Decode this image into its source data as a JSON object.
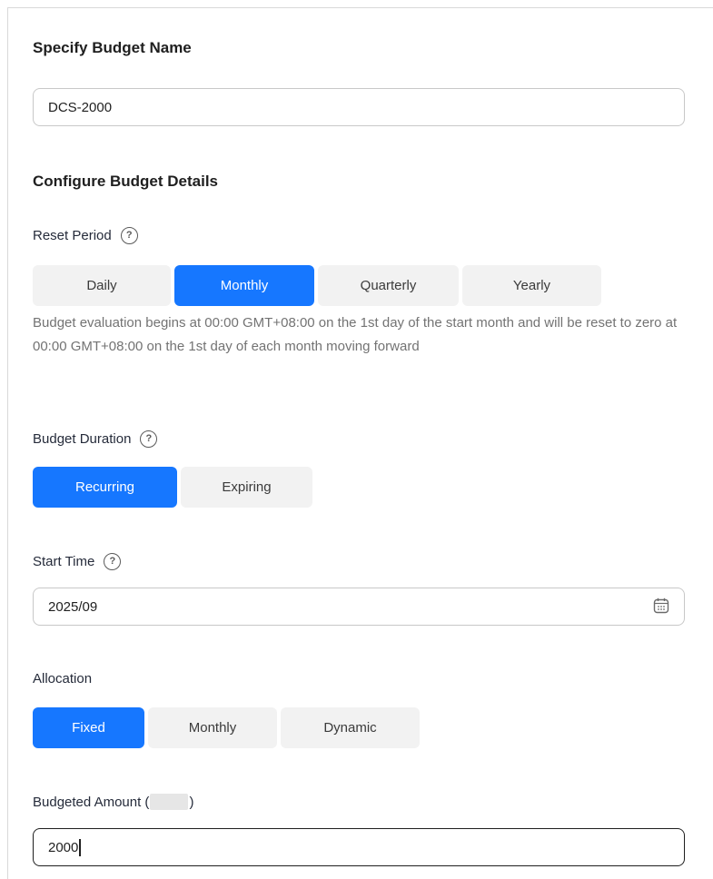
{
  "budget_name": {
    "title": "Specify Budget Name",
    "value": "DCS-2000"
  },
  "details": {
    "title": "Configure Budget Details"
  },
  "reset_period": {
    "label": "Reset Period",
    "options": [
      "Daily",
      "Monthly",
      "Quarterly",
      "Yearly"
    ],
    "selected": "Monthly",
    "hint": "Budget evaluation begins at 00:00 GMT+08:00 on the 1st day of the start month and will be reset to zero at 00:00 GMT+08:00 on the 1st day of each month moving forward"
  },
  "budget_duration": {
    "label": "Budget Duration",
    "options": [
      "Recurring",
      "Expiring"
    ],
    "selected": "Recurring"
  },
  "start_time": {
    "label": "Start Time",
    "value": "2025/09",
    "icon": "calendar-icon"
  },
  "allocation": {
    "label": "Allocation",
    "options": [
      "Fixed",
      "Monthly",
      "Dynamic"
    ],
    "selected": "Fixed"
  },
  "budgeted_amount": {
    "label_prefix": "Budgeted Amount (",
    "label_suffix": ")",
    "value": "2000"
  },
  "colors": {
    "accent": "#1677ff",
    "segment_bg": "#f2f2f2",
    "hint_text": "#737373"
  },
  "help_icon": "question-circle-icon"
}
